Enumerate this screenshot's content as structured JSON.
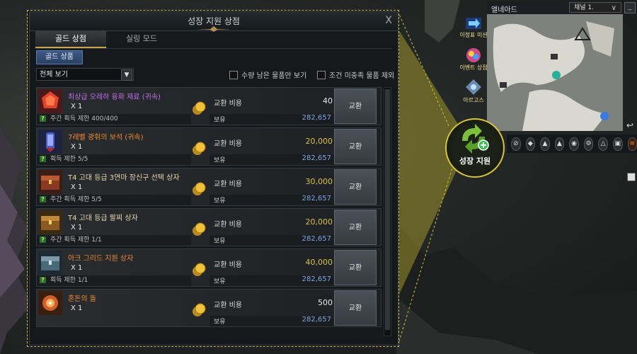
{
  "shop": {
    "title": "성장 지원 상점",
    "close": "X",
    "tabs": [
      {
        "label": "골드 상점",
        "active": true
      },
      {
        "label": "실링 모드",
        "active": false
      }
    ],
    "subtab": "골드 상품",
    "filter": "전체 보기",
    "filter_arrow": "▼",
    "checkbox1": "수량 남은 물품만 보기",
    "checkbox2": "조건 미충족 물품 제외",
    "cost_label": "교환 비용",
    "own_label": "보유",
    "exchange_label": "교환",
    "items": [
      {
        "name": "최상급 오레하 융화 재료 (귀속)",
        "name_color": "#c06ee8",
        "qty": "X 1",
        "limit": "주간 획득 제한 400/400",
        "cost": "40",
        "cost_color": "#e8e8e8",
        "own": "282,657",
        "icon": "orb-red-icon"
      },
      {
        "name": "7레벨 광휘의 보석 (귀속)",
        "name_color": "#f08a2e",
        "qty": "X 1",
        "limit": "획득 제한 5/5",
        "cost": "20,000",
        "cost_color": "#d6c23a",
        "own": "282,657",
        "icon": "gem-icon"
      },
      {
        "name": "T4 고대 등급 3연마 장신구 선택 상자",
        "name_color": "#e6d6b0",
        "qty": "X 1",
        "limit": "주간 획득 제한 5/5",
        "cost": "30,000",
        "cost_color": "#d6c23a",
        "own": "282,657",
        "icon": "chest-red-icon"
      },
      {
        "name": "T4 고대 등급 팔찌 상자",
        "name_color": "#e6d6b0",
        "qty": "X 1",
        "limit": "주간 획득 제한 1/1",
        "cost": "20,000",
        "cost_color": "#d6c23a",
        "own": "282,657",
        "icon": "chest-gold-icon"
      },
      {
        "name": "아크 그리드 지원 상자",
        "name_color": "#f08a2e",
        "qty": "X 1",
        "limit": "획득 제한 1/1",
        "cost": "40,000",
        "cost_color": "#d6c23a",
        "own": "282,657",
        "icon": "chest-blue-icon"
      },
      {
        "name": "혼돈의 돌",
        "name_color": "#f08a2e",
        "qty": "X 1",
        "limit": "",
        "cost": "500",
        "cost_color": "#e8e8e8",
        "own": "282,657",
        "icon": "chaos-stone-icon"
      }
    ]
  },
  "minimap": {
    "region": "엘네아드",
    "channel": "채널 1.",
    "channel_arrow": "∨",
    "minimize": "_",
    "side_buttons": [
      {
        "label": "이정표 미션",
        "icon": "arrow-icon"
      },
      {
        "label": "이벤트 상점",
        "icon": "event-shop-icon"
      },
      {
        "label": "아르고스",
        "icon": "argos-icon"
      }
    ],
    "growth_label": "성장 지원",
    "return_icon": "↩"
  },
  "colors": {
    "highlight": "#d6c43a",
    "own_value": "#7fa6e6",
    "tab_accent": "#c9a24a"
  }
}
